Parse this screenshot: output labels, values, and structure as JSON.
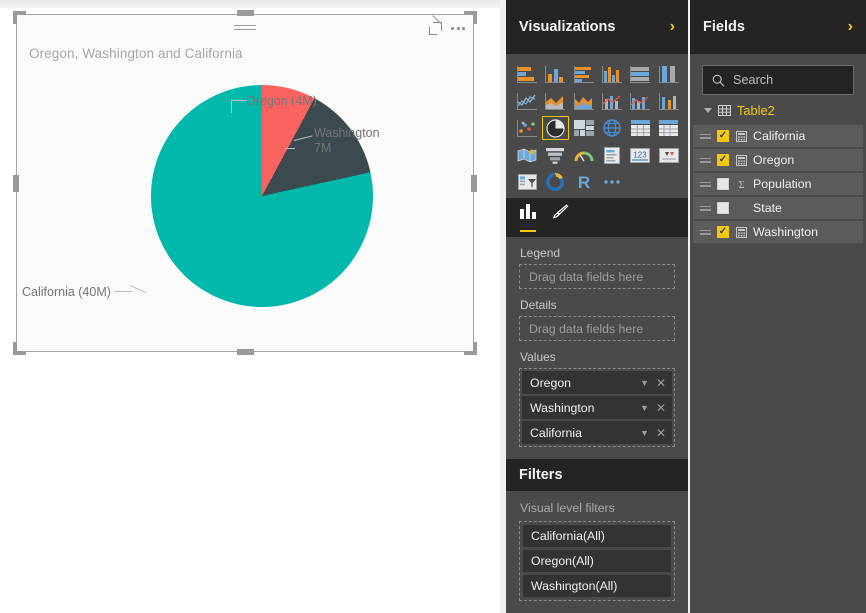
{
  "colors": {
    "teal": "#01b8aa",
    "red": "#fb6360",
    "dark_slate": "#3b4a4f",
    "accent_yellow": "#f2c811",
    "panel_bg": "#4a4a4a",
    "panel_header_bg": "#252423"
  },
  "visual": {
    "title": "Oregon, Washington and California",
    "focus_icon": "focus-mode-icon",
    "more_icon": "more-options-icon",
    "grip_icon": "drag-grip-icon"
  },
  "chart_data": {
    "type": "pie",
    "title": "Oregon, Washington and California",
    "categories": [
      "Oregon",
      "Washington",
      "California"
    ],
    "values": [
      4,
      7,
      40
    ],
    "unit": "M",
    "labels": [
      "Oregon (4M)",
      "Washington\n7M",
      "California (40M)"
    ],
    "label_oregon": "Oregon (4M)",
    "label_washington_line1": "Washington",
    "label_washington_line2": "7M",
    "label_california": "California (40M)",
    "colors": [
      "#fb6360",
      "#3b4a4f",
      "#01b8aa"
    ],
    "legend": "none",
    "grid": false
  },
  "visualizations": {
    "title": "Visualizations",
    "collapse_icon": "chevron-right-icon",
    "icons": [
      {
        "name": "stacked-bar-chart-icon",
        "selected": false
      },
      {
        "name": "stacked-column-chart-icon",
        "selected": false
      },
      {
        "name": "clustered-bar-chart-icon",
        "selected": false
      },
      {
        "name": "clustered-column-chart-icon",
        "selected": false
      },
      {
        "name": "hundred-percent-stacked-bar-chart-icon",
        "selected": false
      },
      {
        "name": "hundred-percent-stacked-column-chart-icon",
        "selected": false
      },
      {
        "name": "line-chart-icon",
        "selected": false
      },
      {
        "name": "area-chart-icon",
        "selected": false
      },
      {
        "name": "stacked-area-chart-icon",
        "selected": false
      },
      {
        "name": "line-and-stacked-column-chart-icon",
        "selected": false
      },
      {
        "name": "line-and-clustered-column-chart-icon",
        "selected": false
      },
      {
        "name": "ribbon-chart-icon",
        "selected": false
      },
      {
        "name": "scatter-chart-icon",
        "selected": false
      },
      {
        "name": "pie-chart-icon",
        "selected": true
      },
      {
        "name": "treemap-icon",
        "selected": false
      },
      {
        "name": "map-globe-icon",
        "selected": false
      },
      {
        "name": "table-icon",
        "selected": false
      },
      {
        "name": "matrix-icon",
        "selected": false
      },
      {
        "name": "filled-map-icon",
        "selected": false
      },
      {
        "name": "funnel-chart-icon",
        "selected": false
      },
      {
        "name": "gauge-icon",
        "selected": false
      },
      {
        "name": "card-icon",
        "selected": false
      },
      {
        "name": "multi-row-card-icon",
        "selected": false
      },
      {
        "name": "kpi-icon",
        "selected": false
      },
      {
        "name": "slicer-icon",
        "selected": false
      },
      {
        "name": "donut-chart-icon",
        "selected": false
      },
      {
        "name": "r-script-visual-icon",
        "selected": false
      },
      {
        "name": "more-visuals-icon",
        "selected": false
      }
    ],
    "tabs": [
      {
        "name": "fields-tab",
        "icon": "bar-chart-icon",
        "active": true
      },
      {
        "name": "format-tab",
        "icon": "paintbrush-icon",
        "active": false
      }
    ],
    "wells": [
      {
        "label": "Legend",
        "placeholder": "Drag data fields here",
        "items": []
      },
      {
        "label": "Details",
        "placeholder": "Drag data fields here",
        "items": []
      },
      {
        "label": "Values",
        "placeholder": "",
        "items": [
          "Oregon",
          "Washington",
          "California"
        ]
      }
    ],
    "legend_label": "Legend",
    "legend_placeholder": "Drag data fields here",
    "details_label": "Details",
    "details_placeholder": "Drag data fields here",
    "values_label": "Values",
    "values": [
      "Oregon",
      "Washington",
      "California"
    ],
    "chip_dropdown_icon": "chevron-down-icon",
    "chip_remove_icon": "close-icon"
  },
  "filters": {
    "title": "Filters",
    "section_label": "Visual level filters",
    "items": [
      "California(All)",
      "Oregon(All)",
      "Washington(All)"
    ]
  },
  "fields": {
    "title": "Fields",
    "collapse_icon": "chevron-right-icon",
    "search_placeholder": "Search",
    "search_icon": "search-icon",
    "search_value": "",
    "table": "Table2",
    "table_icon": "table-icon",
    "items": [
      {
        "label": "California",
        "checked": true,
        "icon": "measure-icon"
      },
      {
        "label": "Oregon",
        "checked": true,
        "icon": "measure-icon"
      },
      {
        "label": "Population",
        "checked": false,
        "icon": "sum-sigma-icon"
      },
      {
        "label": "State",
        "checked": false,
        "icon": "none"
      },
      {
        "label": "Washington",
        "checked": true,
        "icon": "measure-icon"
      }
    ]
  }
}
